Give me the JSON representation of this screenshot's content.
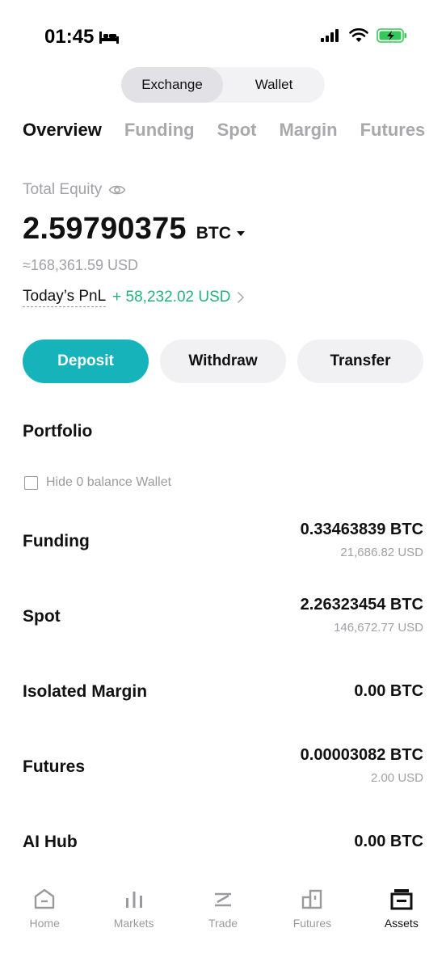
{
  "status": {
    "time": "01:45"
  },
  "segmented": {
    "exchange": "Exchange",
    "wallet": "Wallet"
  },
  "tabs": [
    "Overview",
    "Funding",
    "Spot",
    "Margin",
    "Futures"
  ],
  "equity": {
    "label": "Total Equity",
    "value": "2.59790375",
    "unit": "BTC",
    "usd": "≈168,361.59 USD",
    "pnl_label": "Today’s PnL",
    "pnl_value": "+ 58,232.02 USD"
  },
  "actions": {
    "deposit": "Deposit",
    "withdraw": "Withdraw",
    "transfer": "Transfer"
  },
  "portfolio": {
    "title": "Portfolio",
    "hide_zero": "Hide 0 balance Wallet",
    "rows": [
      {
        "name": "Funding",
        "btc": "0.33463839 BTC",
        "usd": "21,686.82 USD"
      },
      {
        "name": "Spot",
        "btc": "2.26323454 BTC",
        "usd": "146,672.77 USD"
      },
      {
        "name": "Isolated Margin",
        "btc": "0.00 BTC",
        "usd": ""
      },
      {
        "name": "Futures",
        "btc": "0.00003082 BTC",
        "usd": "2.00 USD"
      },
      {
        "name": "AI Hub",
        "btc": "0.00 BTC",
        "usd": ""
      }
    ]
  },
  "nav": [
    "Home",
    "Markets",
    "Trade",
    "Futures",
    "Assets"
  ],
  "colors": {
    "accent": "#17b3ba",
    "positive": "#23b27a",
    "muted": "#a1a1a6"
  }
}
